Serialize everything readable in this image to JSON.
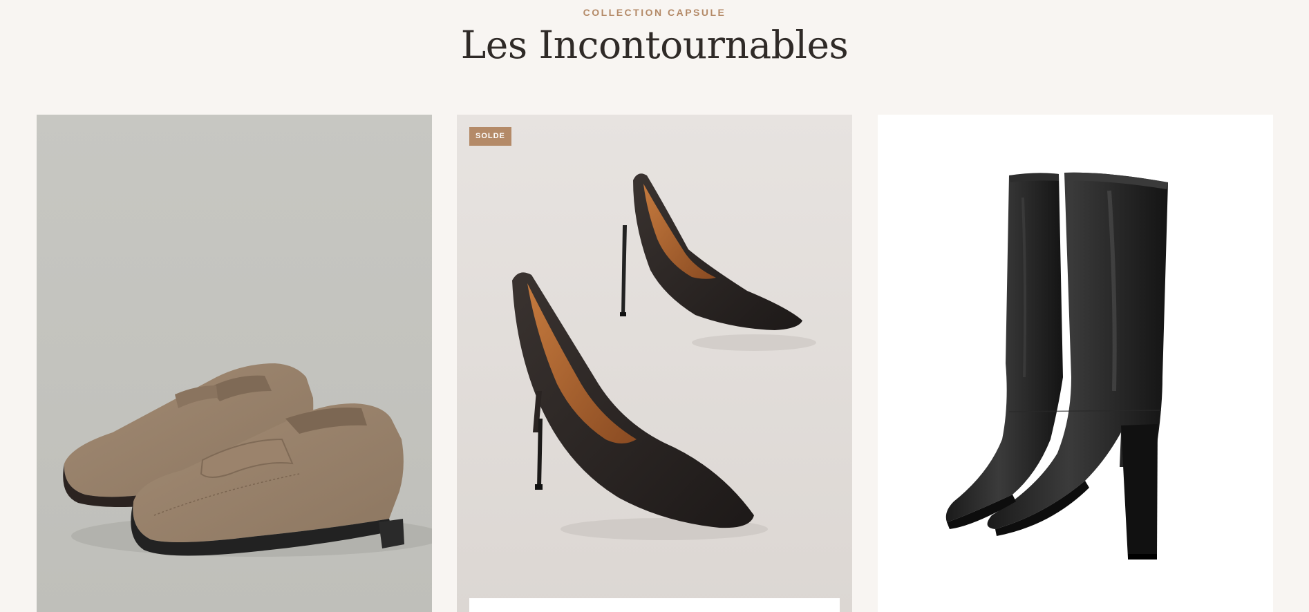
{
  "section": {
    "eyebrow": "COLLECTION CAPSULE",
    "title": "Les Incontournables"
  },
  "products": [
    {
      "image_icon": "loafer-shoes-image",
      "badge": null
    },
    {
      "image_icon": "stiletto-pumps-image",
      "badge": "SOLDE"
    },
    {
      "image_icon": "knee-high-boots-image",
      "badge": null
    }
  ],
  "colors": {
    "background": "#f8f5f2",
    "accent": "#b48a68",
    "heading": "#2f2a27"
  }
}
